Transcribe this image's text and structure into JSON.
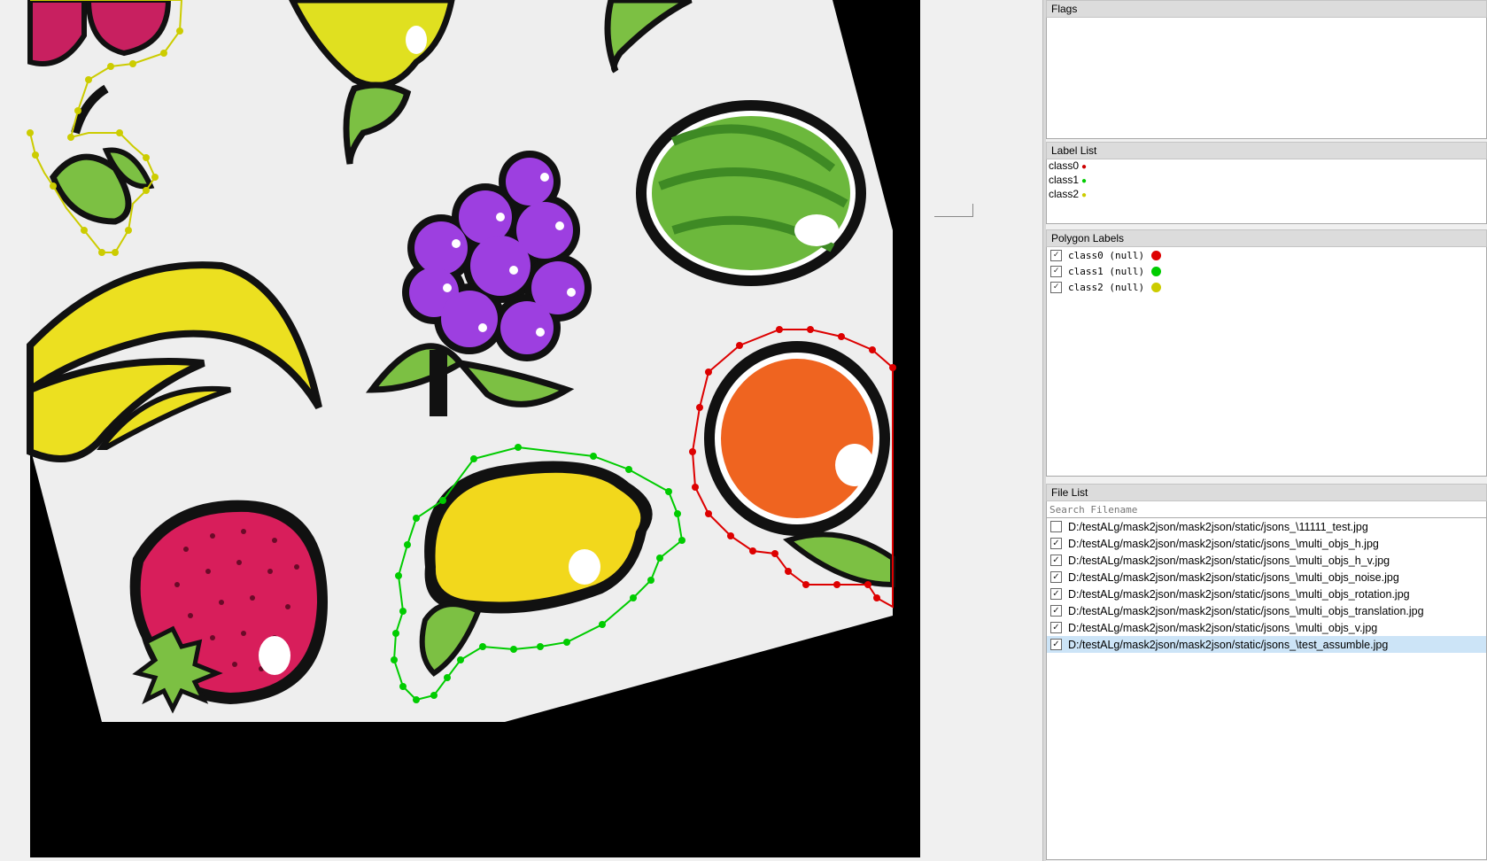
{
  "panels": {
    "flags": {
      "title": "Flags"
    },
    "label_list": {
      "title": "Label List",
      "items": [
        {
          "name": "class0",
          "color": "#cc0000"
        },
        {
          "name": "class1",
          "color": "#00cc00"
        },
        {
          "name": "class2",
          "color": "#cccc00"
        }
      ]
    },
    "polygon_labels": {
      "title": "Polygon Labels",
      "items": [
        {
          "label": "class0 (null)",
          "checked": true,
          "color": "#dd0000"
        },
        {
          "label": "class1 (null)",
          "checked": true,
          "color": "#00cc00"
        },
        {
          "label": "class2 (null)",
          "checked": true,
          "color": "#cccc00"
        }
      ]
    },
    "file_list": {
      "title": "File List",
      "search_placeholder": "Search Filename",
      "files": [
        {
          "path": "D:/testALg/mask2json/mask2json/static/jsons_\\11111_test.jpg",
          "checked": false,
          "selected": false
        },
        {
          "path": "D:/testALg/mask2json/mask2json/static/jsons_\\multi_objs_h.jpg",
          "checked": true,
          "selected": false
        },
        {
          "path": "D:/testALg/mask2json/mask2json/static/jsons_\\multi_objs_h_v.jpg",
          "checked": true,
          "selected": false
        },
        {
          "path": "D:/testALg/mask2json/mask2json/static/jsons_\\multi_objs_noise.jpg",
          "checked": true,
          "selected": false
        },
        {
          "path": "D:/testALg/mask2json/mask2json/static/jsons_\\multi_objs_rotation.jpg",
          "checked": true,
          "selected": false
        },
        {
          "path": "D:/testALg/mask2json/mask2json/static/jsons_\\multi_objs_translation.jpg",
          "checked": true,
          "selected": false
        },
        {
          "path": "D:/testALg/mask2json/mask2json/static/jsons_\\multi_objs_v.jpg",
          "checked": true,
          "selected": false
        },
        {
          "path": "D:/testALg/mask2json/mask2json/static/jsons_\\test_assumble.jpg",
          "checked": true,
          "selected": true
        }
      ]
    }
  }
}
